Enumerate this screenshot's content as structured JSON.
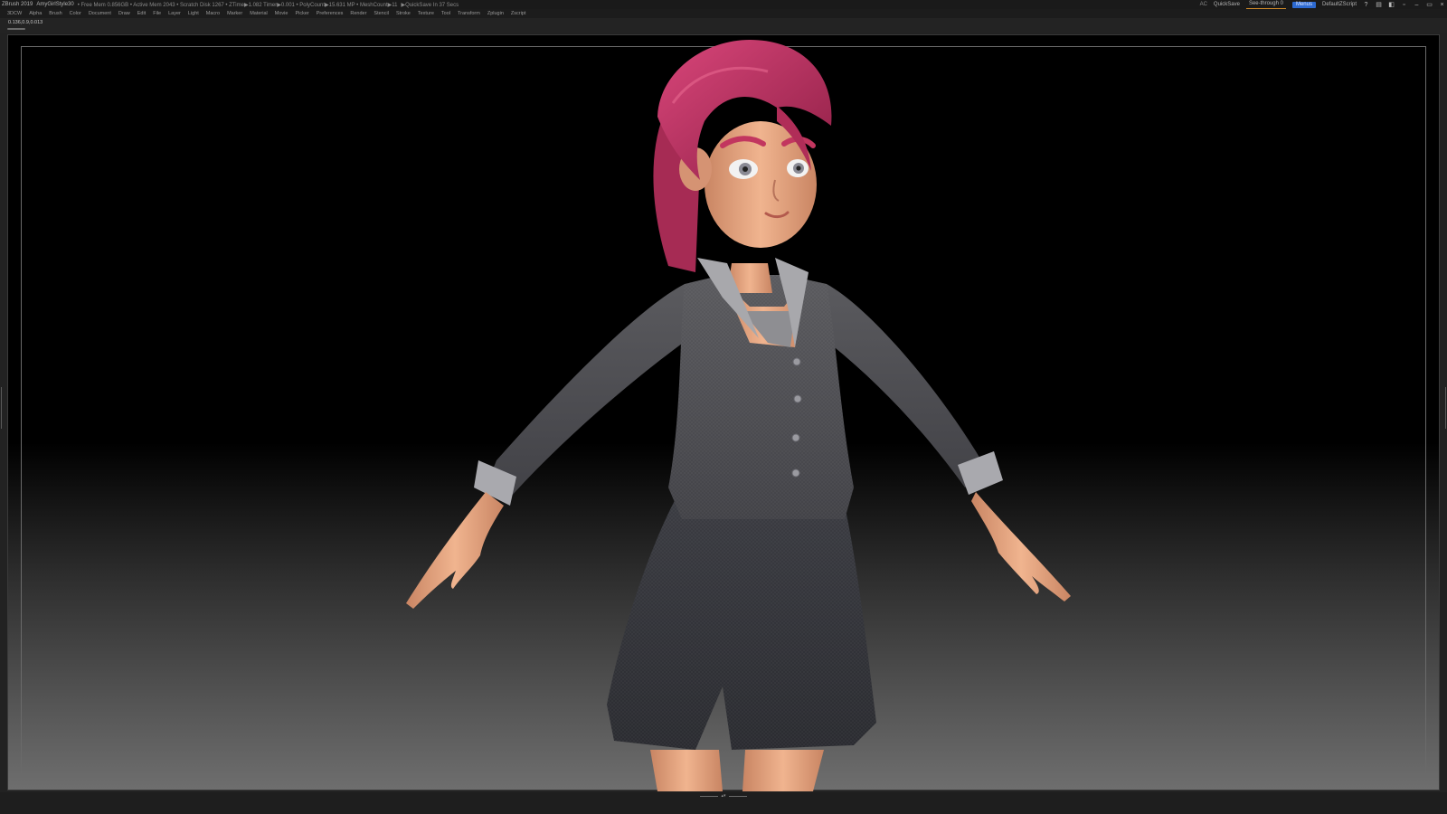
{
  "title_bar": {
    "app_name": "ZBrush 2019",
    "document_name": "AmyGirlStyle30",
    "status_text": "• Free Mem 0.856GB • Active Mem 2043 • Scratch Disk 1267 • ZTime▶1.082 Timer▶0.001 • PolyCount▶15.631 MP • MeshCount▶11",
    "quicksave_status": "▶QuickSave In 37 Secs",
    "ac_label": "AC",
    "quicksave_label": "QuickSave",
    "see_through_label": "See-through  0",
    "menus_label": "Menus",
    "script_label": "DefaultZScript",
    "icons": [
      "help-icon",
      "layout-icon",
      "palette-icon",
      "lock-icon",
      "minimize-icon",
      "restore-icon",
      "close-icon"
    ]
  },
  "menu_bar": {
    "items": [
      "3DCW",
      "Alpha",
      "Brush",
      "Color",
      "Document",
      "Draw",
      "Edit",
      "File",
      "Layer",
      "Light",
      "Macro",
      "Marker",
      "Material",
      "Movie",
      "Picker",
      "Preferences",
      "Render",
      "Stencil",
      "Stroke",
      "Texture",
      "Tool",
      "Transform",
      "Zplugin",
      "Zscript"
    ]
  },
  "sub_bar": {
    "coordinates": "0.136,0.9,0.013"
  },
  "viewport": {
    "background_top": "#000000",
    "background_bottom": "#6e6e6e",
    "subject": "3D cartoon girl character model in T-pose",
    "colors": {
      "hair": "#c2365f",
      "skin": "#e2a27f",
      "jacket": "#4b4b4f",
      "collar": "#a8a8ac",
      "skirt": "#34353b"
    }
  }
}
